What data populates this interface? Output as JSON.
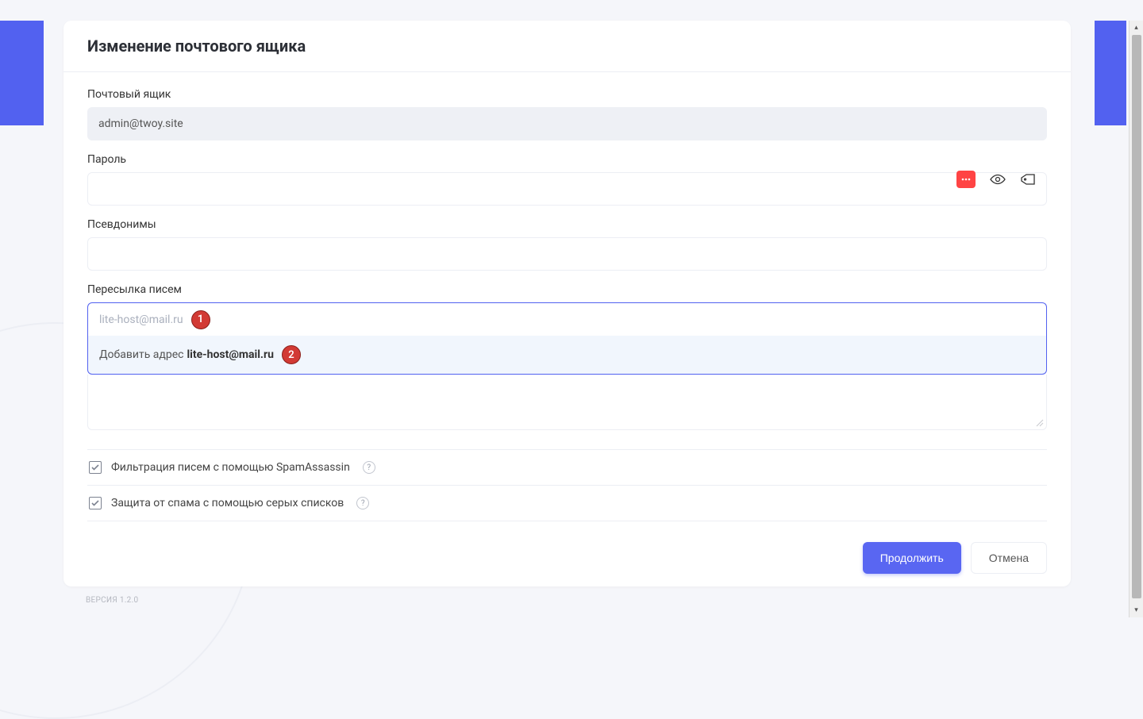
{
  "header": {
    "title": "Изменение почтового ящика"
  },
  "mailbox": {
    "label": "Почтовый ящик",
    "value": "admin@twoy.site"
  },
  "password": {
    "label": "Пароль",
    "value": ""
  },
  "aliases": {
    "label": "Псевдонимы",
    "value": ""
  },
  "forwarding": {
    "label": "Пересылка писем",
    "input_value": "lite-host@mail.ru",
    "dropdown_prefix": "Добавить адрес",
    "dropdown_value": "lite-host@mail.ru"
  },
  "checkboxes": {
    "spamassassin": "Фильтрация писем с помощью SpamAssassin",
    "greylist": "Защита от спама с помощью серых списков"
  },
  "buttons": {
    "continue": "Продолжить",
    "cancel": "Отмена"
  },
  "annotations": {
    "badge1": "1",
    "badge2": "2"
  },
  "footer": {
    "version": "ВЕРСИЯ 1.2.0"
  },
  "icons": {
    "password_generate": "password-dots-icon",
    "password_reveal": "eye-icon",
    "password_save": "tag-icon",
    "help": "?"
  }
}
